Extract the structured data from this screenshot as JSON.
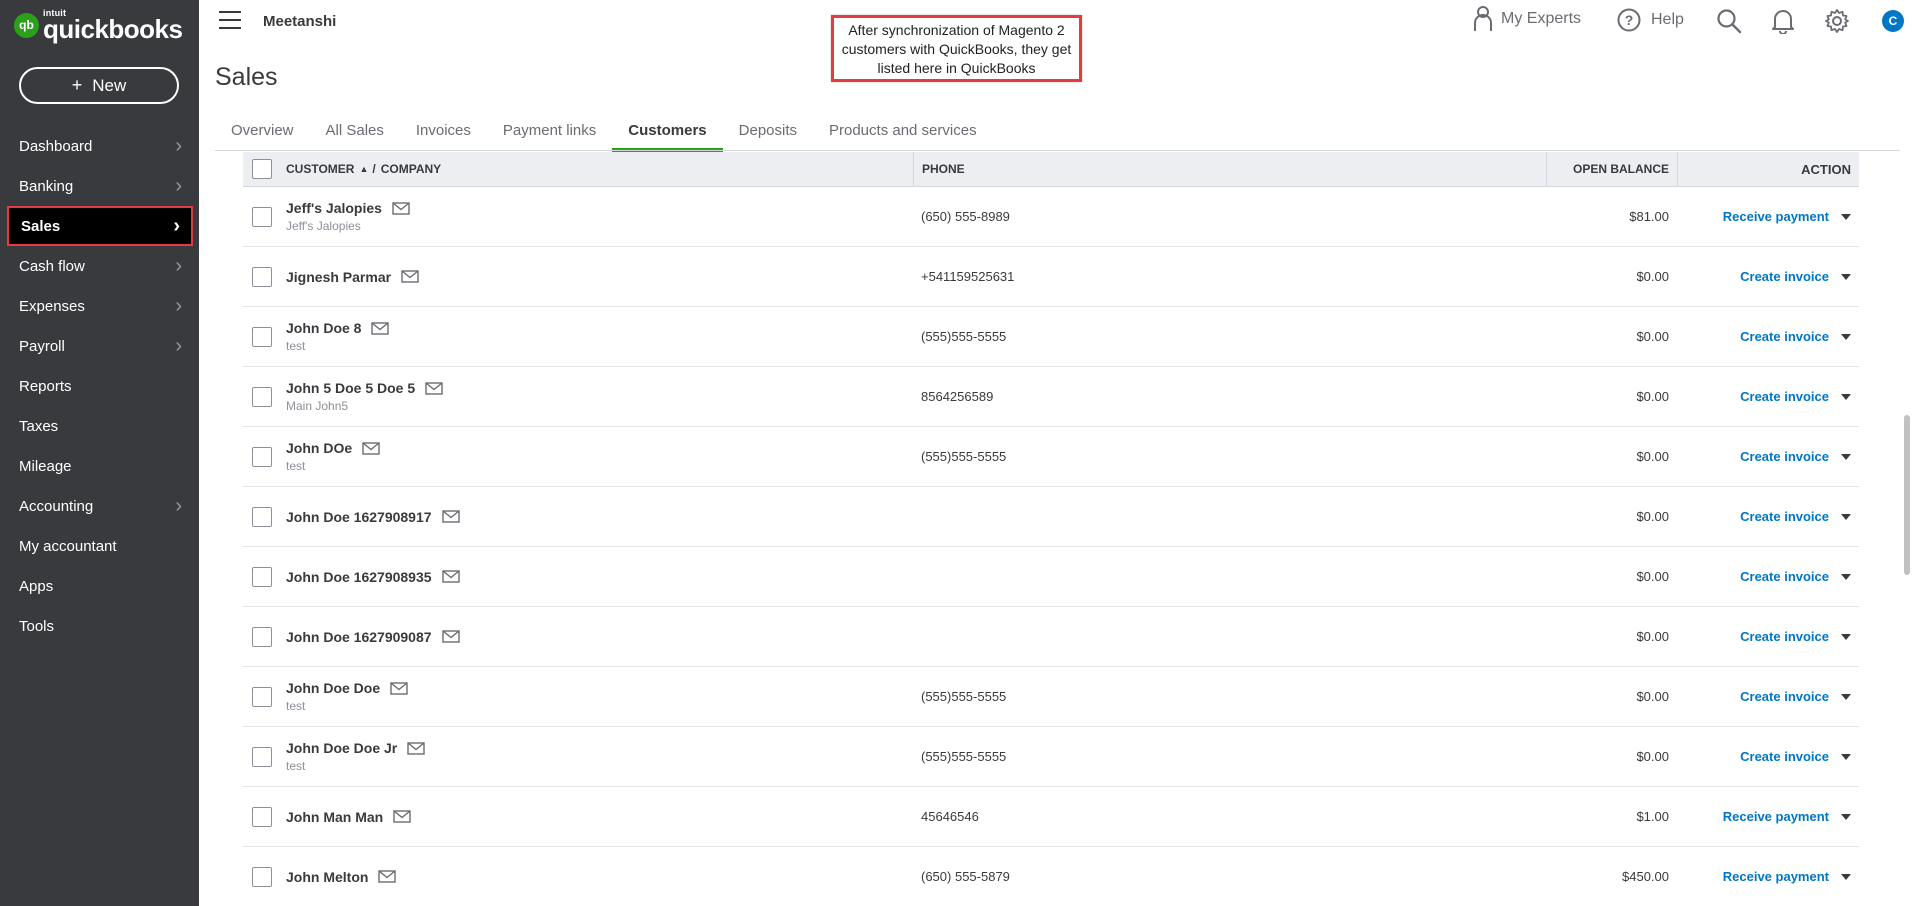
{
  "brand": {
    "intuit": "intuit",
    "product": "quickbooks",
    "mark": "qb"
  },
  "new_button": {
    "label": "New",
    "icon": "plus-icon"
  },
  "sidebar": {
    "items": [
      {
        "label": "Dashboard",
        "has_chevron": true
      },
      {
        "label": "Banking",
        "has_chevron": true
      },
      {
        "label": "Sales",
        "has_chevron": true,
        "active": true
      },
      {
        "label": "Cash flow",
        "has_chevron": true
      },
      {
        "label": "Expenses",
        "has_chevron": true
      },
      {
        "label": "Payroll",
        "has_chevron": true
      },
      {
        "label": "Reports",
        "has_chevron": false
      },
      {
        "label": "Taxes",
        "has_chevron": false
      },
      {
        "label": "Mileage",
        "has_chevron": false
      },
      {
        "label": "Accounting",
        "has_chevron": true
      },
      {
        "label": "My accountant",
        "has_chevron": false
      },
      {
        "label": "Apps",
        "has_chevron": false
      },
      {
        "label": "Tools",
        "has_chevron": false
      }
    ]
  },
  "header": {
    "company": "Meetanshi",
    "my_experts": "My Experts",
    "help": "Help",
    "avatar_initial": "C"
  },
  "annotation": {
    "text": "After synchronization of Magento 2 customers with QuickBooks, they get listed here in QuickBooks"
  },
  "page_title": "Sales",
  "tabs": [
    {
      "label": "Overview"
    },
    {
      "label": "All Sales"
    },
    {
      "label": "Invoices"
    },
    {
      "label": "Payment links"
    },
    {
      "label": "Customers",
      "active": true
    },
    {
      "label": "Deposits"
    },
    {
      "label": "Products and services"
    }
  ],
  "table": {
    "headers": {
      "customer": "CUSTOMER",
      "sep": "/",
      "company": "COMPANY",
      "phone": "PHONE",
      "open_balance": "OPEN BALANCE",
      "action": "ACTION"
    },
    "rows": [
      {
        "name": "Jeff's Jalopies",
        "sub": "Jeff's Jalopies",
        "phone": "(650) 555-8989",
        "balance": "$81.00",
        "action": "Receive payment"
      },
      {
        "name": "Jignesh Parmar",
        "sub": "",
        "phone": "+541159525631",
        "balance": "$0.00",
        "action": "Create invoice"
      },
      {
        "name": "John Doe 8",
        "sub": "test",
        "phone": "(555)555-5555",
        "balance": "$0.00",
        "action": "Create invoice"
      },
      {
        "name": "John 5 Doe 5 Doe 5",
        "sub": "Main John5",
        "phone": "8564256589",
        "balance": "$0.00",
        "action": "Create invoice"
      },
      {
        "name": "John DOe",
        "sub": "test",
        "phone": "(555)555-5555",
        "balance": "$0.00",
        "action": "Create invoice"
      },
      {
        "name": "John Doe 1627908917",
        "sub": "",
        "phone": "",
        "balance": "$0.00",
        "action": "Create invoice"
      },
      {
        "name": "John Doe 1627908935",
        "sub": "",
        "phone": "",
        "balance": "$0.00",
        "action": "Create invoice"
      },
      {
        "name": "John Doe 1627909087",
        "sub": "",
        "phone": "",
        "balance": "$0.00",
        "action": "Create invoice"
      },
      {
        "name": "John Doe Doe",
        "sub": "test",
        "phone": "(555)555-5555",
        "balance": "$0.00",
        "action": "Create invoice"
      },
      {
        "name": "John Doe Doe Jr",
        "sub": "test",
        "phone": "(555)555-5555",
        "balance": "$0.00",
        "action": "Create invoice"
      },
      {
        "name": "John Man Man",
        "sub": "",
        "phone": "45646546",
        "balance": "$1.00",
        "action": "Receive payment"
      },
      {
        "name": "John Melton",
        "sub": "",
        "phone": "(650) 555-5879",
        "balance": "$450.00",
        "action": "Receive payment"
      }
    ]
  },
  "colors": {
    "sidebar_bg": "#393a3d",
    "accent_green": "#2ca01c",
    "link_blue": "#0077c5",
    "highlight_red": "#e23b43"
  },
  "icons": [
    "hamburger-menu-icon",
    "my-experts-icon",
    "help-icon",
    "search-icon",
    "bell-icon",
    "gear-icon",
    "mail-icon",
    "chevron-right-icon",
    "caret-down-icon",
    "sort-up-icon"
  ]
}
